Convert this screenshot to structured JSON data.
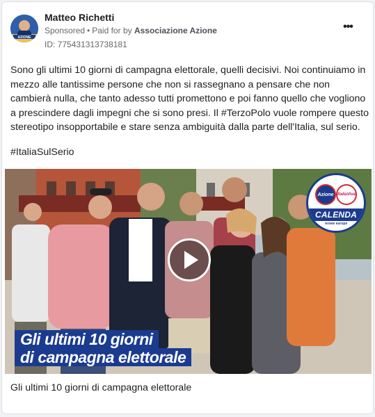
{
  "post": {
    "author": "Matteo Richetti",
    "sponsored_label": "Sponsored",
    "separator": "•",
    "paid_for_prefix": "Paid for by",
    "paid_for_by": "Associazione Azione",
    "id_label": "ID: 775431313738181",
    "more_icon": "more-horizontal-icon",
    "body": "Sono gli ultimi 10 giorni di campagna elettorale, quelli decisivi. Noi continuiamo in mezzo alle tantissime persone che non si rassegnano a pensare che non cambierà nulla, che tanto adesso tutti promettono e poi fanno quello che vogliono a prescindere dagli impegni che si sono presi. Il #TerzoPolo vuole rompere questo stereotipo insopportabile e stare senza ambiguità dalla parte dell'Italia, sul serio.",
    "hashtag": "#ItaliaSulSerio",
    "avatar_text": "AZIONE"
  },
  "video": {
    "overlay_line1": "Gli ultimi 10 giorni",
    "overlay_line2": "di campagna elettorale",
    "play_icon": "play-icon",
    "logo": {
      "left_mark": "Azione",
      "right_mark": "ItaliaViva",
      "name": "CALENDA",
      "subtitle": "renew europe"
    },
    "caption": "Gli ultimi 10 giorni di campagna elettorale"
  },
  "colors": {
    "brand_blue": "#1b3b8f",
    "accent_red": "#d8262e",
    "text_primary": "#1c1e21",
    "text_secondary": "#65676b",
    "card_border": "#dddfe2",
    "background": "#f0f2f5"
  }
}
